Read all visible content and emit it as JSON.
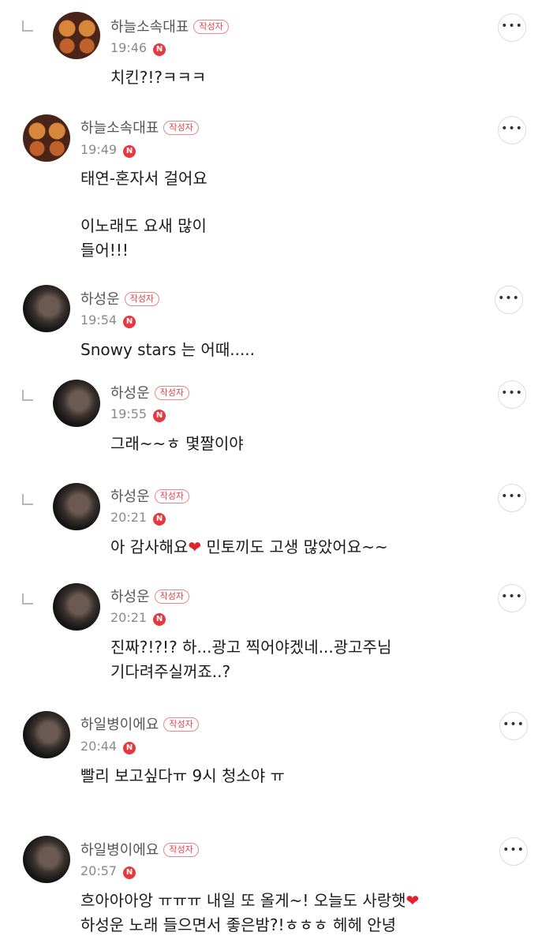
{
  "author_badge": "작성자",
  "new_label": "N",
  "more_symbol": "•••",
  "heart_symbol": "❤",
  "colors": {
    "badge": "#e0414b",
    "new_dot": "#e5393f",
    "heart": "#e02330"
  },
  "comments": [
    {
      "name": "하늘소속대표",
      "time": "19:46",
      "reply": true,
      "avatar_icon": "avatar-2-orange",
      "lines": [
        "치킨?!?ㅋㅋㅋ"
      ]
    },
    {
      "name": "하늘소속대표",
      "time": "19:49",
      "reply": false,
      "avatar_icon": "avatar-2-orange",
      "lines": [
        "태연-혼자서 걸어요",
        "",
        "이노래도 요새 많이",
        "들어!!!"
      ]
    },
    {
      "name": "하성운",
      "time": "19:54",
      "reply": false,
      "avatar_icon": "avatar-photo",
      "lines": [
        "Snowy stars 는 어때....."
      ]
    },
    {
      "name": "하성운",
      "time": "19:55",
      "reply": true,
      "avatar_icon": "avatar-photo",
      "lines": [
        "그래~~ㅎ 몇짤이야"
      ]
    },
    {
      "name": "하성운",
      "time": "20:21",
      "reply": true,
      "avatar_icon": "avatar-photo",
      "line_a": "아 감사해요",
      "line_b": " 민토끼도 고생 많았어요~~"
    },
    {
      "name": "하성운",
      "time": "20:21",
      "reply": true,
      "avatar_icon": "avatar-photo",
      "lines": [
        "진짜?!?!? 하...광고 찍어야겠네...광고주님",
        "기다려주실꺼죠..?"
      ]
    },
    {
      "name": "하일병이에요",
      "time": "20:44",
      "reply": false,
      "avatar_icon": "avatar-photo",
      "lines": [
        "빨리 보고싶다ㅠ 9시 청소야 ㅠ"
      ]
    },
    {
      "name": "하일병이에요",
      "time": "20:57",
      "reply": false,
      "avatar_icon": "avatar-photo",
      "line_a": "흐아아아앙 ㅠㅠㅠ 내일 또 올게~! 오늘도 사랑햇",
      "line_b": "하성운 노래 들으면서 좋은밤?!ㅎㅎㅎ 헤헤 안녕"
    }
  ]
}
